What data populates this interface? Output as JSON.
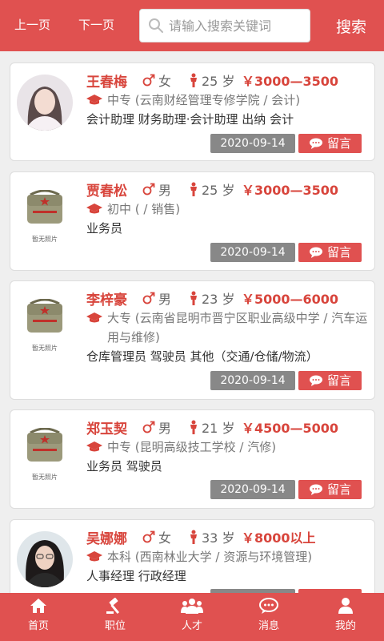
{
  "header": {
    "prev_label": "上一页",
    "next_label": "下一页",
    "search_placeholder": "请输入搜索关键词",
    "search_button": "搜索"
  },
  "colors": {
    "brand": "#e05150",
    "name_red": "#d8453c",
    "date_gray": "#888888"
  },
  "no_photo_text": "暂无照片",
  "candidates": [
    {
      "name": "王春梅",
      "gender": "女",
      "age": "25 岁",
      "salary": "￥3000—3500",
      "education": "中专 (云南财经管理专修学院 / 会计)",
      "jobs": "会计助理 财务助理·会计助理 出纳 会计",
      "date": "2020-09-14",
      "message_label": "留言",
      "photo": "portrait-female-1"
    },
    {
      "name": "贾春松",
      "gender": "男",
      "age": "25 岁",
      "salary": "￥3000—3500",
      "education": "初中 ( / 销售)",
      "jobs": "业务员",
      "date": "2020-09-14",
      "message_label": "留言",
      "photo": "no-photo-bag"
    },
    {
      "name": "李梓豪",
      "gender": "男",
      "age": "23 岁",
      "salary": "￥5000—6000",
      "education": "大专 (云南省昆明市晋宁区职业高级中学 / 汽车运用与维修)",
      "jobs": "仓库管理员 驾驶员 其他（交通/仓储/物流）",
      "date": "2020-09-14",
      "message_label": "留言",
      "photo": "no-photo-bag"
    },
    {
      "name": "郑玉契",
      "gender": "男",
      "age": "21 岁",
      "salary": "￥4500—5000",
      "education": "中专 (昆明高级技工学校 / 汽修)",
      "jobs": "业务员 驾驶员",
      "date": "2020-09-14",
      "message_label": "留言",
      "photo": "no-photo-bag"
    },
    {
      "name": "吴娜娜",
      "gender": "女",
      "age": "33 岁",
      "salary": "￥8000以上",
      "education": "本科 (西南林业大学 / 资源与环境管理)",
      "jobs": "人事经理 行政经理",
      "date": "",
      "message_label": "",
      "photo": "portrait-female-2"
    }
  ],
  "nav": [
    {
      "label": "首页",
      "icon": "home-icon"
    },
    {
      "label": "职位",
      "icon": "gavel-icon"
    },
    {
      "label": "人才",
      "icon": "users-icon"
    },
    {
      "label": "消息",
      "icon": "chat-icon"
    },
    {
      "label": "我的",
      "icon": "user-icon"
    }
  ]
}
